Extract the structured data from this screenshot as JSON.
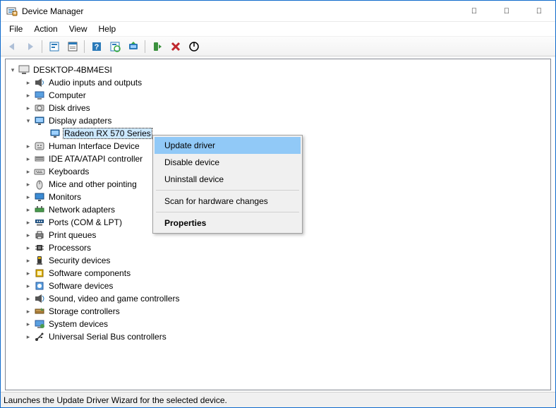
{
  "window": {
    "title": "Device Manager"
  },
  "menubar": [
    "File",
    "Action",
    "View",
    "Help"
  ],
  "statusbar": "Launches the Update Driver Wizard for the selected device.",
  "tree": {
    "root": "DESKTOP-4BM4ESI",
    "children": [
      {
        "label": "Audio inputs and outputs",
        "icon": "audio"
      },
      {
        "label": "Computer",
        "icon": "computer"
      },
      {
        "label": "Disk drives",
        "icon": "disk"
      },
      {
        "label": "Display adapters",
        "icon": "display",
        "expanded": true,
        "children": [
          {
            "label": "Radeon RX 570 Series",
            "icon": "display",
            "selected": true
          }
        ]
      },
      {
        "label": "Human Interface Device",
        "icon": "hid",
        "truncated": true
      },
      {
        "label": "IDE ATA/ATAPI controller",
        "icon": "ide",
        "truncated": true
      },
      {
        "label": "Keyboards",
        "icon": "keyboard"
      },
      {
        "label": "Mice and other pointing",
        "icon": "mouse",
        "truncated": true
      },
      {
        "label": "Monitors",
        "icon": "monitor"
      },
      {
        "label": "Network adapters",
        "icon": "network"
      },
      {
        "label": "Ports (COM & LPT)",
        "icon": "ports"
      },
      {
        "label": "Print queues",
        "icon": "printer"
      },
      {
        "label": "Processors",
        "icon": "processor"
      },
      {
        "label": "Security devices",
        "icon": "security"
      },
      {
        "label": "Software components",
        "icon": "softcomp"
      },
      {
        "label": "Software devices",
        "icon": "softdev"
      },
      {
        "label": "Sound, video and game controllers",
        "icon": "sound"
      },
      {
        "label": "Storage controllers",
        "icon": "storagectl"
      },
      {
        "label": "System devices",
        "icon": "system"
      },
      {
        "label": "Universal Serial Bus controllers",
        "icon": "usb"
      }
    ]
  },
  "context_menu": [
    {
      "label": "Update driver",
      "highlight": true
    },
    {
      "label": "Disable device"
    },
    {
      "label": "Uninstall device"
    },
    {
      "sep": true
    },
    {
      "label": "Scan for hardware changes"
    },
    {
      "sep": true
    },
    {
      "label": "Properties",
      "bold": true
    }
  ]
}
